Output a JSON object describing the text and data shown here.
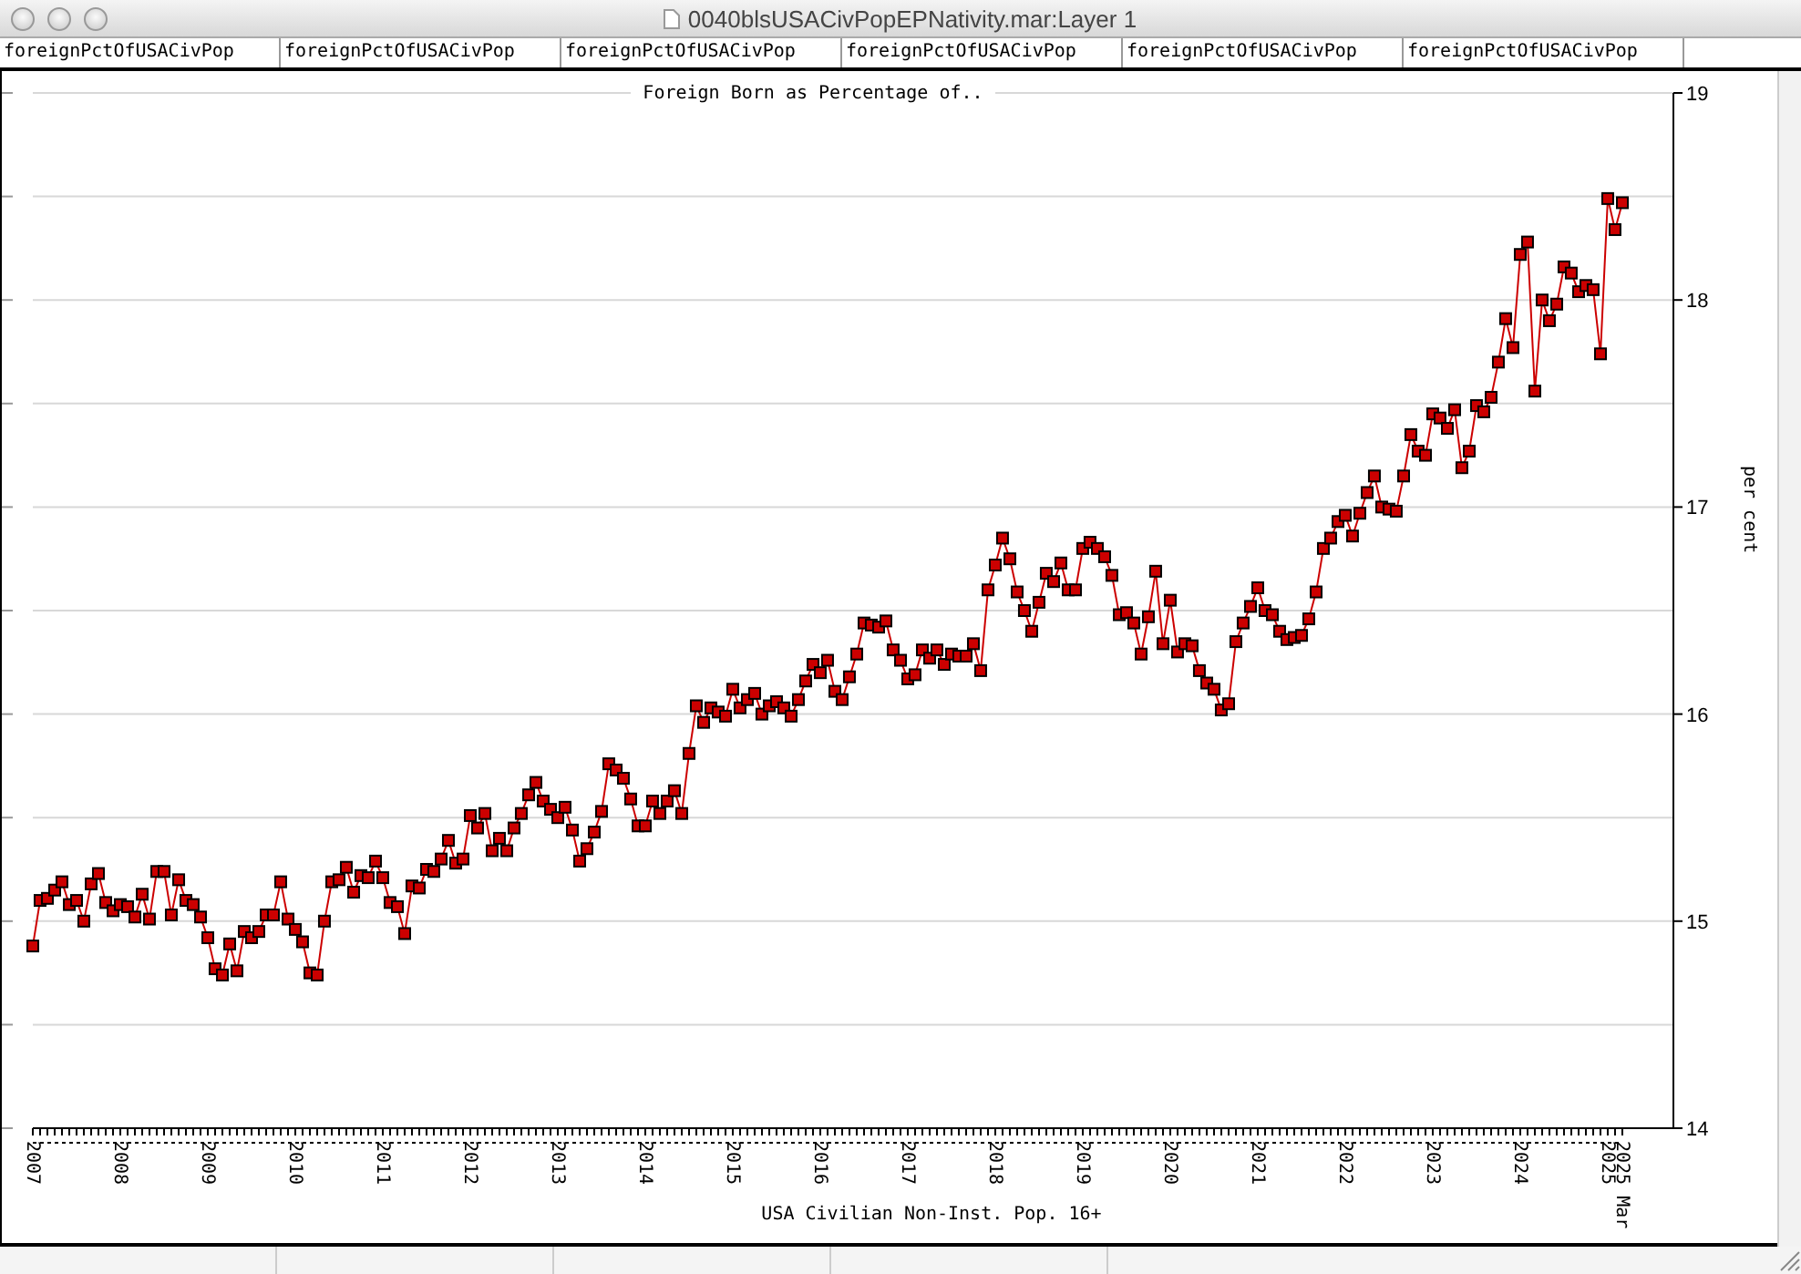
{
  "window": {
    "title": "0040blsUSACivPopEPNativity.mar:Layer 1"
  },
  "header_cells": [
    "foreignPctOfUSACivPop",
    "foreignPctOfUSACivPop",
    "foreignPctOfUSACivPop",
    "foreignPctOfUSACivPop",
    "foreignPctOfUSACivPop",
    "foreignPctOfUSACivPop"
  ],
  "chart": {
    "chart_data": {
      "type": "line",
      "title": "Foreign Born as Percentage of..",
      "xlabel": "USA Civilian Non-Inst. Pop. 16+",
      "ylabel": "per cent",
      "xlim": [
        2007,
        2025.167
      ],
      "ylim": [
        14,
        19
      ],
      "yticks": [
        14,
        15,
        16,
        17,
        18,
        19
      ],
      "xticks": [
        2007,
        2008,
        2009,
        2010,
        2011,
        2012,
        2013,
        2014,
        2015,
        2016,
        2017,
        2018,
        2019,
        2020,
        2021,
        2022,
        2023,
        2024,
        2025,
        {
          "value": 2025.167,
          "label": "2025 Mar"
        }
      ],
      "grid": true,
      "x": [
        2007,
        2007.083,
        2007.167,
        2007.25,
        2007.333,
        2007.417,
        2007.5,
        2007.583,
        2007.667,
        2007.75,
        2007.833,
        2007.917,
        2008,
        2008.083,
        2008.167,
        2008.25,
        2008.333,
        2008.417,
        2008.5,
        2008.583,
        2008.667,
        2008.75,
        2008.833,
        2008.917,
        2009,
        2009.083,
        2009.167,
        2009.25,
        2009.333,
        2009.417,
        2009.5,
        2009.583,
        2009.667,
        2009.75,
        2009.833,
        2009.917,
        2010,
        2010.083,
        2010.167,
        2010.25,
        2010.333,
        2010.417,
        2010.5,
        2010.583,
        2010.667,
        2010.75,
        2010.833,
        2010.917,
        2011,
        2011.083,
        2011.167,
        2011.25,
        2011.333,
        2011.417,
        2011.5,
        2011.583,
        2011.667,
        2011.75,
        2011.833,
        2011.917,
        2012,
        2012.083,
        2012.167,
        2012.25,
        2012.333,
        2012.417,
        2012.5,
        2012.583,
        2012.667,
        2012.75,
        2012.833,
        2012.917,
        2013,
        2013.083,
        2013.167,
        2013.25,
        2013.333,
        2013.417,
        2013.5,
        2013.583,
        2013.667,
        2013.75,
        2013.833,
        2013.917,
        2014,
        2014.083,
        2014.167,
        2014.25,
        2014.333,
        2014.417,
        2014.5,
        2014.583,
        2014.667,
        2014.75,
        2014.833,
        2014.917,
        2015,
        2015.083,
        2015.167,
        2015.25,
        2015.333,
        2015.417,
        2015.5,
        2015.583,
        2015.667,
        2015.75,
        2015.833,
        2015.917,
        2016,
        2016.083,
        2016.167,
        2016.25,
        2016.333,
        2016.417,
        2016.5,
        2016.583,
        2016.667,
        2016.75,
        2016.833,
        2016.917,
        2017,
        2017.083,
        2017.167,
        2017.25,
        2017.333,
        2017.417,
        2017.5,
        2017.583,
        2017.667,
        2017.75,
        2017.833,
        2017.917,
        2018,
        2018.083,
        2018.167,
        2018.25,
        2018.333,
        2018.417,
        2018.5,
        2018.583,
        2018.667,
        2018.75,
        2018.833,
        2018.917,
        2019,
        2019.083,
        2019.167,
        2019.25,
        2019.333,
        2019.417,
        2019.5,
        2019.583,
        2019.667,
        2019.75,
        2019.833,
        2019.917,
        2020,
        2020.083,
        2020.167,
        2020.25,
        2020.333,
        2020.417,
        2020.5,
        2020.583,
        2020.667,
        2020.75,
        2020.833,
        2020.917,
        2021,
        2021.083,
        2021.167,
        2021.25,
        2021.333,
        2021.417,
        2021.5,
        2021.583,
        2021.667,
        2021.75,
        2021.833,
        2021.917,
        2022,
        2022.083,
        2022.167,
        2022.25,
        2022.333,
        2022.417,
        2022.5,
        2022.583,
        2022.667,
        2022.75,
        2022.833,
        2022.917,
        2023,
        2023.083,
        2023.167,
        2023.25,
        2023.333,
        2023.417,
        2023.5,
        2023.583,
        2023.667,
        2023.75,
        2023.833,
        2023.917,
        2024,
        2024.083,
        2024.167,
        2024.25,
        2024.333,
        2024.417,
        2024.5,
        2024.583,
        2024.667,
        2024.75,
        2024.833,
        2024.917,
        2025,
        2025.083,
        2025.167
      ],
      "series": [
        {
          "color": "#cc0000",
          "marker": "square",
          "values": [
            14.88,
            15.1,
            15.11,
            15.15,
            15.19,
            15.08,
            15.1,
            15.0,
            15.18,
            15.23,
            15.09,
            15.05,
            15.08,
            15.07,
            15.02,
            15.13,
            15.01,
            15.24,
            15.24,
            15.03,
            15.2,
            15.1,
            15.08,
            15.02,
            14.92,
            14.77,
            14.74,
            14.89,
            14.76,
            14.95,
            14.92,
            14.95,
            15.03,
            15.03,
            15.19,
            15.01,
            14.96,
            14.9,
            14.75,
            14.74,
            15.0,
            15.19,
            15.2,
            15.26,
            15.14,
            15.22,
            15.21,
            15.29,
            15.21,
            15.09,
            15.07,
            14.94,
            15.17,
            15.16,
            15.25,
            15.24,
            15.3,
            15.39,
            15.28,
            15.3,
            15.51,
            15.45,
            15.52,
            15.34,
            15.4,
            15.34,
            15.45,
            15.52,
            15.61,
            15.67,
            15.58,
            15.54,
            15.5,
            15.55,
            15.44,
            15.29,
            15.35,
            15.43,
            15.53,
            15.76,
            15.73,
            15.69,
            15.59,
            15.46,
            15.46,
            15.58,
            15.52,
            15.58,
            15.63,
            15.52,
            15.81,
            16.04,
            15.96,
            16.03,
            16.01,
            15.99,
            16.12,
            16.03,
            16.07,
            16.1,
            16.0,
            16.04,
            16.06,
            16.03,
            15.99,
            16.07,
            16.16,
            16.24,
            16.2,
            16.26,
            16.11,
            16.07,
            16.18,
            16.29,
            16.44,
            16.43,
            16.42,
            16.45,
            16.31,
            16.26,
            16.17,
            16.19,
            16.31,
            16.27,
            16.31,
            16.24,
            16.29,
            16.28,
            16.28,
            16.34,
            16.21,
            16.6,
            16.72,
            16.85,
            16.75,
            16.59,
            16.5,
            16.4,
            16.54,
            16.68,
            16.64,
            16.73,
            16.6,
            16.6,
            16.8,
            16.83,
            16.8,
            16.76,
            16.67,
            16.48,
            16.49,
            16.44,
            16.29,
            16.47,
            16.69,
            16.34,
            16.55,
            16.3,
            16.34,
            16.33,
            16.21,
            16.15,
            16.12,
            16.02,
            16.05,
            16.35,
            16.44,
            16.52,
            16.61,
            16.5,
            16.48,
            16.4,
            16.36,
            16.37,
            16.38,
            16.46,
            16.59,
            16.8,
            16.85,
            16.93,
            16.96,
            16.86,
            16.97,
            17.07,
            17.15,
            17.0,
            16.99,
            16.98,
            17.15,
            17.35,
            17.27,
            17.25,
            17.45,
            17.43,
            17.38,
            17.47,
            17.19,
            17.27,
            17.49,
            17.46,
            17.53,
            17.7,
            17.91,
            17.77,
            18.22,
            18.28,
            17.56,
            18.0,
            17.9,
            17.98,
            18.16,
            18.13,
            18.04,
            18.07,
            18.05,
            17.74,
            18.49,
            18.34,
            18.47
          ]
        }
      ]
    }
  }
}
